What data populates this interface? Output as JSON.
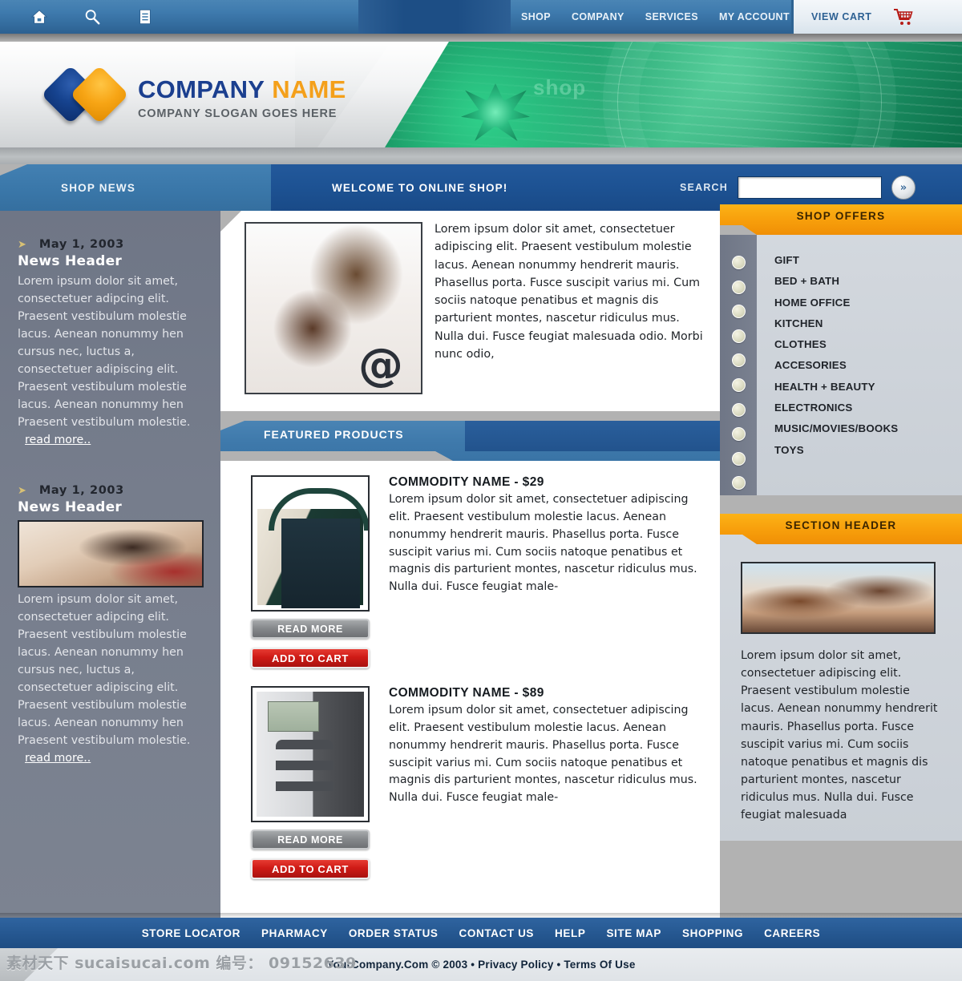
{
  "topnav": {
    "icons": [
      {
        "name": "home-icon"
      },
      {
        "name": "search-icon"
      },
      {
        "name": "document-icon"
      }
    ],
    "links": [
      {
        "label": "SHOP"
      },
      {
        "label": "COMPANY"
      },
      {
        "label": "SERVICES"
      },
      {
        "label": "MY ACCOUNT"
      }
    ],
    "view_cart": "VIEW CART",
    "cart_icon": "shopping-cart-icon"
  },
  "masthead": {
    "logo_name_1": "COMPANY",
    "logo_name_2": "NAME",
    "slogan": "COMPANY SLOGAN GOES HERE",
    "banner_word": "shop"
  },
  "bars": {
    "shop_news_tab": "SHOP NEWS",
    "welcome_title": "WELCOME TO ONLINE SHOP!"
  },
  "search": {
    "label": "SEARCH",
    "value": "",
    "placeholder": "",
    "go_glyph": "»"
  },
  "news": [
    {
      "arrow": "→",
      "date": "May 1, 2003",
      "header": "News Header",
      "body": "Lorem ipsum dolor sit amet, consectetuer adipcing elit. Praesent vestibulum molestie lacus. Aenean nonummy hen cursus nec, luctus a, consectetuer adipiscing elit. Praesent vestibulum molestie lacus. Aenean nonummy hen Praesent vestibulum molestie.",
      "read_more": "read more..",
      "has_photo": false
    },
    {
      "arrow": "→",
      "date": "May 1, 2003",
      "header": "News Header",
      "body": "Lorem ipsum dolor sit amet, consectetuer adipcing elit. Praesent vestibulum molestie lacus. Aenean nonummy hen cursus nec, luctus a, consectetuer adipiscing elit. Praesent vestibulum molestie lacus. Aenean nonummy hen Praesent vestibulum molestie.",
      "read_more": "read more..",
      "has_photo": true,
      "photo_alt": "woman-shopping-photo"
    }
  ],
  "welcome": {
    "photo_alt": "smiling-couple-photo",
    "photo_overlay": "@",
    "text": "Lorem ipsum dolor sit amet, consectetuer adipiscing elit. Praesent vestibulum molestie lacus. Aenean nonummy hendrerit mauris. Phasellus porta. Fusce suscipit varius mi. Cum sociis natoque penatibus et magnis dis parturient montes, nascetur ridiculus mus. Nulla dui. Fusce feugiat malesuada odio. Morbi nunc odio,"
  },
  "featured": {
    "header": "FEATURED PRODUCTS",
    "products": [
      {
        "title": "COMMODITY NAME - $29",
        "desc": "Lorem ipsum dolor sit amet, consectetuer adipiscing elit. Praesent vestibulum molestie lacus. Aenean nonummy hendrerit mauris. Phasellus porta. Fusce suscipit varius mi. Cum sociis natoque penatibus et magnis dis parturient montes, nascetur ridiculus mus. Nulla dui. Fusce feugiat male-",
        "read_more": "READ MORE",
        "add_to_cart": "ADD TO CART",
        "thumb_alt": "tote-bags-photo"
      },
      {
        "title": "COMMODITY NAME - $89",
        "desc": "Lorem ipsum dolor sit amet, consectetuer adipiscing elit. Praesent vestibulum molestie lacus. Aenean nonummy hendrerit mauris. Phasellus porta. Fusce suscipit varius mi. Cum sociis natoque penatibus et magnis dis parturient montes, nascetur ridiculus mus. Nulla dui. Fusce feugiat male-",
        "read_more": "READ MORE",
        "add_to_cart": "ADD TO CART",
        "thumb_alt": "mp3-player-photo"
      }
    ]
  },
  "offers": {
    "header": "SHOP  OFFERS",
    "items": [
      {
        "label": "GIFT"
      },
      {
        "label": "BED + BATH"
      },
      {
        "label": "HOME OFFICE"
      },
      {
        "label": "KITCHEN"
      },
      {
        "label": "CLOTHES"
      },
      {
        "label": "ACCESORIES"
      },
      {
        "label": "HEALTH + BEAUTY"
      },
      {
        "label": "ELECTRONICS"
      },
      {
        "label": "MUSIC/MOVIES/BOOKS"
      },
      {
        "label": "TOYS"
      }
    ]
  },
  "section_panel": {
    "header": "SECTION HEADER",
    "photo_alt": "happy-couple-photo",
    "text": "Lorem ipsum dolor sit amet, consectetuer adipiscing elit. Praesent vestibulum molestie lacus. Aenean nonummy hendrerit mauris. Phasellus porta. Fusce suscipit varius mi. Cum sociis natoque penatibus et magnis dis parturient montes, nascetur ridiculus mus. Nulla dui. Fusce feugiat malesuada"
  },
  "footer": {
    "links": [
      {
        "label": "STORE LOCATOR"
      },
      {
        "label": "PHARMACY"
      },
      {
        "label": "ORDER STATUS"
      },
      {
        "label": "CONTACT US"
      },
      {
        "label": "HELP"
      },
      {
        "label": "SITE MAP"
      },
      {
        "label": "SHOPPING"
      },
      {
        "label": "CAREERS"
      }
    ],
    "legal": "YourCompany.Com © 2003 • Privacy Policy • Terms Of Use"
  },
  "watermark": {
    "text": "素材天下 sucaisucai.com  编号： 09152639"
  },
  "colors": {
    "nav_blue": "#3a77a8",
    "welcome_blue": "#1d5293",
    "accent_orange": "#f79e0b",
    "logo_blue": "#1b3f8f",
    "logo_gold": "#f4a01b",
    "cart_red": "#cf1b16",
    "sidebar_gray": "#767d8c",
    "panel_gray": "#cfd5dc",
    "banner_green": "#21a470"
  }
}
